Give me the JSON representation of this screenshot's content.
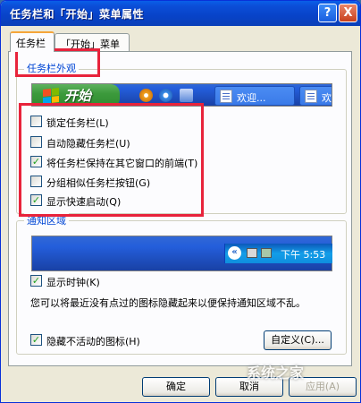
{
  "window": {
    "title": "任务栏和「开始」菜单属性",
    "help_label": "?",
    "close_label": "X"
  },
  "tabs": [
    {
      "label": "任务栏",
      "active": true
    },
    {
      "label": "「开始」菜单",
      "active": false
    }
  ],
  "appearance": {
    "group_title": "任务栏外观",
    "taskbar": {
      "start_label": "开始",
      "task_buttons": [
        "欢迎...",
        "欢迎"
      ]
    },
    "options": [
      {
        "label": "锁定任务栏(L)",
        "checked": false
      },
      {
        "label": "自动隐藏任务栏(U)",
        "checked": false
      },
      {
        "label": "将任务栏保持在其它窗口的前端(T)",
        "checked": true
      },
      {
        "label": "分组相似任务栏按钮(G)",
        "checked": false
      },
      {
        "label": "显示快速启动(Q)",
        "checked": true
      }
    ]
  },
  "notification": {
    "group_title": "通知区域",
    "clock": "下午 5:53",
    "show_clock": {
      "label": "显示时钟(K)",
      "checked": true
    },
    "description": "您可以将最近没有点过的图标隐藏起来以便保持通知区域不乱。",
    "hide_inactive": {
      "label": "隐藏不活动的图标(H)",
      "checked": true
    },
    "customize_label": "自定义(C)..."
  },
  "buttons": {
    "ok": "确定",
    "cancel": "取消",
    "apply": "应用(A)"
  },
  "watermark": "系统之家",
  "colors": {
    "highlight": "#e8233b",
    "titlebar": "#0a5fe8",
    "group_title": "#0046d5"
  }
}
